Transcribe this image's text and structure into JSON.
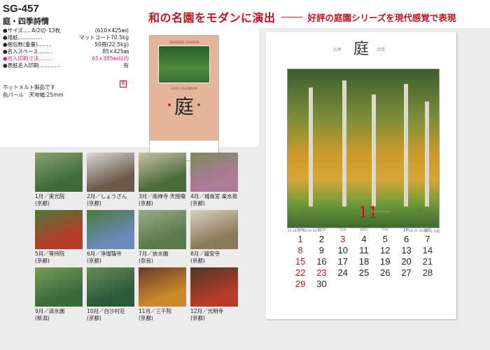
{
  "headline": {
    "main": "和の名園をモダンに演出",
    "sub": "好評の庭園シリーズを現代感覚で表現"
  },
  "product": {
    "code": "SG-457",
    "title": "庭・四季詩情",
    "specs": [
      {
        "k": "●サイズ‥‥ A/2切･13枚",
        "v": "(610×425㎜)",
        "hl": false
      },
      {
        "k": "●用紙‥‥‥‥‥‥‥",
        "v": "マットコート70.5kg",
        "hl": false
      },
      {
        "k": "●梱包数(重量)‥‥‥‥",
        "v": "50冊(22.5kg)",
        "hl": false
      },
      {
        "k": "●名入スペース‥‥‥‥",
        "v": "85×425㎜",
        "hl": false
      },
      {
        "k": "●名入印刷寸法‥‥‥‥",
        "v": "65×385㎜以内",
        "hl": true
      },
      {
        "k": "●表紙名入印刷‥‥‥‥‥‥",
        "v": "有",
        "hl": false
      }
    ],
    "notes": [
      "ホットメルト製品です",
      "色パール　天地幅:25mm"
    ],
    "stamp": "紙"
  },
  "cover": {
    "caption": "SEASONS GARDEN",
    "caption2": "2021 CALENDAR",
    "kanji": "庭"
  },
  "thumbs": [
    {
      "label": "1月／実光院",
      "sub": "(京都)",
      "c1": "#3f6b3a",
      "c2": "#8aa070"
    },
    {
      "label": "2月／しょうざん",
      "sub": "(京都)",
      "c1": "#6b5a48",
      "c2": "#d8d8d8"
    },
    {
      "label": "3月／南禅寺 天授庵",
      "sub": "(京都)",
      "c1": "#4a6d38",
      "c2": "#c8c0a8"
    },
    {
      "label": "4月／城南宮 楽水苑",
      "sub": "(京都)",
      "c1": "#b07a9a",
      "c2": "#7a8a5a"
    },
    {
      "label": "5月／等持院",
      "sub": "(京都)",
      "c1": "#b83a2a",
      "c2": "#4a7a3a"
    },
    {
      "label": "6月／浄瑠璃寺",
      "sub": "(京都)",
      "c1": "#6a8ab8",
      "c2": "#4a7a3a"
    },
    {
      "label": "7月／依水園",
      "sub": "(奈良)",
      "c1": "#5a7a4a",
      "c2": "#9aaa8a"
    },
    {
      "label": "8月／龍安寺",
      "sub": "(京都)",
      "c1": "#8a7a5a",
      "c2": "#d8d0c0"
    },
    {
      "label": "9月／清水園",
      "sub": "(新潟)",
      "c1": "#3a6a3a",
      "c2": "#7a9a5a"
    },
    {
      "label": "10月／白沙村荘",
      "sub": "(京都)",
      "c1": "#2a5a3a",
      "c2": "#6a8a5a"
    },
    {
      "label": "11月／三千院",
      "sub": "(京都)",
      "c1": "#c88a2a",
      "c2": "#6a3a2a"
    },
    {
      "label": "12月／光明寺",
      "sub": "(京都)",
      "c1": "#b83a2a",
      "c2": "#4a3a2a"
    }
  ],
  "sheet": {
    "head_kanji": "庭",
    "head_left": "四季",
    "head_right": "詩情",
    "photo_caption": "三千院 京都",
    "month": "11",
    "month_en": "November",
    "dows": [
      "SUN",
      "MON",
      "TUE",
      "WED",
      "THU",
      "FRI",
      "SAT"
    ],
    "weeks": [
      [
        "1",
        "2",
        "3",
        "4",
        "5",
        "6",
        "7"
      ],
      [
        "8",
        "9",
        "10",
        "11",
        "12",
        "13",
        "14"
      ],
      [
        "15",
        "16",
        "17",
        "18",
        "19",
        "20",
        "21"
      ],
      [
        "22",
        "23",
        "24",
        "25",
        "26",
        "27",
        "28"
      ],
      [
        "29",
        "30",
        "",
        "",
        "",
        "",
        ""
      ]
    ],
    "holidays": [
      "3",
      "23"
    ],
    "mini_prev": {
      "m": "10",
      "days": [
        "",
        "",
        "",
        "",
        "1",
        "2",
        "3",
        "4",
        "5",
        "6",
        "7",
        "8",
        "9",
        "10",
        "11",
        "12",
        "13",
        "14",
        "15",
        "16",
        "17",
        "18",
        "19",
        "20",
        "21",
        "22",
        "23",
        "24",
        "25",
        "26",
        "27",
        "28",
        "29",
        "30",
        "31"
      ]
    },
    "mini_next": {
      "m": "12",
      "days": [
        "",
        "",
        "1",
        "2",
        "3",
        "4",
        "5",
        "6",
        "7",
        "8",
        "9",
        "10",
        "11",
        "12",
        "13",
        "14",
        "15",
        "16",
        "17",
        "18",
        "19",
        "20",
        "21",
        "22",
        "23",
        "24",
        "25",
        "26",
        "27",
        "28",
        "29",
        "30",
        "31"
      ]
    }
  },
  "colors": {
    "accent": "#c1121f",
    "highlight": "#d6247a",
    "panel": "#ececec"
  }
}
